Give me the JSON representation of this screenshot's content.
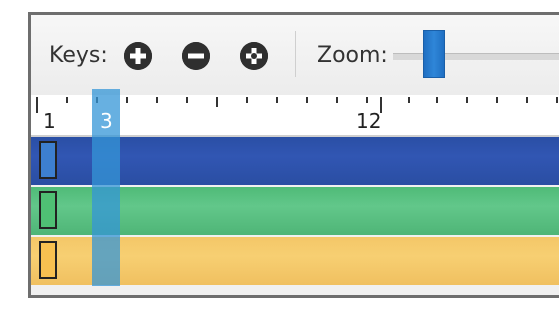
{
  "toolbar": {
    "keys_label": "Keys:",
    "zoom_label": "Zoom:",
    "add_key_icon": "plus-circle-icon",
    "remove_key_icon": "minus-circle-icon",
    "key_options_icon": "plus-circle-alt-icon",
    "zoom_level": 0.2
  },
  "ruler": {
    "labels": [
      "1",
      "12"
    ]
  },
  "playhead": {
    "frame_label": "3"
  },
  "tracks": [
    {
      "color": "#2f52ad",
      "key_color": "#3d7fd0"
    },
    {
      "color": "#5cc283",
      "key_color": "#4fbf74"
    },
    {
      "color": "#f6cc6e",
      "key_color": "#f7c050"
    }
  ]
}
